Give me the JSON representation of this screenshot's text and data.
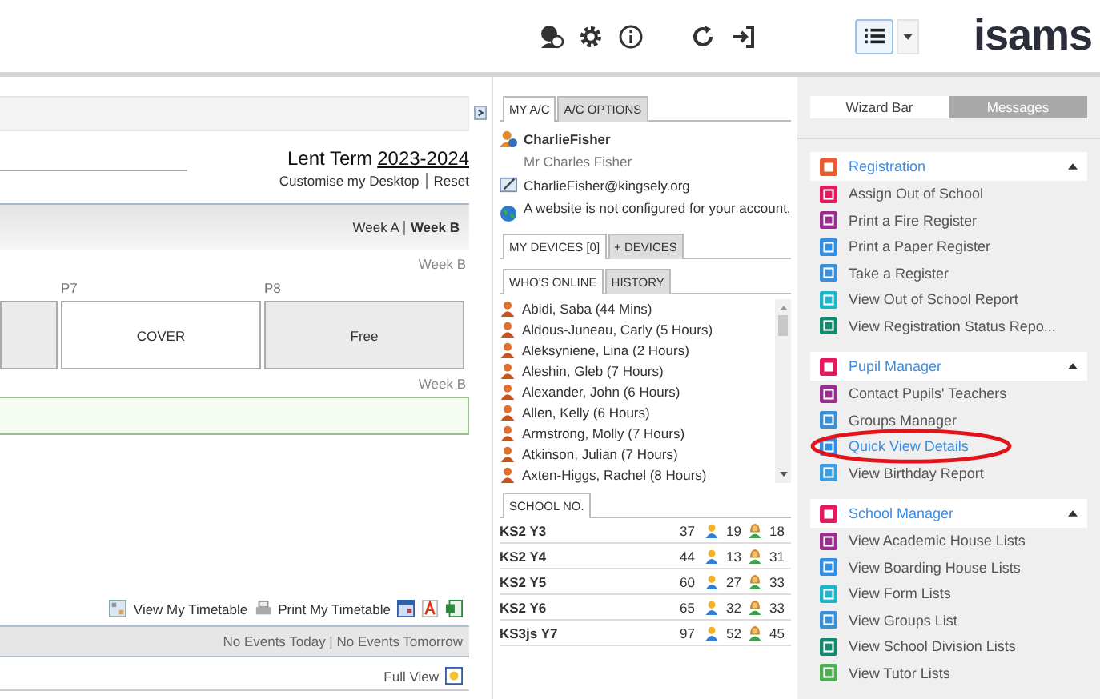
{
  "toolbar": {
    "logo": "isams"
  },
  "desktop": {
    "term": "Lent Term",
    "year": "2023-2024",
    "links": [
      "Customise my Desktop",
      "Reset"
    ],
    "weeks": [
      {
        "label": "Week A",
        "selected": false
      },
      {
        "label": "Week B",
        "selected": true
      }
    ],
    "week_label_top": "Week B",
    "periods": [
      {
        "label": "P7",
        "cell": "COVER",
        "kind": "cover"
      },
      {
        "label": "P8",
        "cell": "Free",
        "kind": "free"
      }
    ],
    "week_label_bottom": "Week B",
    "timetable_links": [
      "View My Timetable",
      "Print My Timetable"
    ],
    "events": "No Events Today | No Events Tomorrow",
    "full_view": "Full View"
  },
  "account": {
    "tabs": [
      {
        "label": "MY A/C",
        "selected": true
      },
      {
        "label": "A/C OPTIONS",
        "selected": false
      }
    ],
    "username": "CharlieFisher",
    "full_name": "Mr Charles Fisher",
    "email": "CharlieFisher@kingsely.org",
    "website": "A website is not configured for your account.",
    "device_tabs": [
      {
        "label": "MY DEVICES [0]",
        "selected": true
      },
      {
        "label": "+ DEVICES",
        "selected": false
      }
    ],
    "online_tabs": [
      {
        "label": "WHO'S ONLINE",
        "selected": true
      },
      {
        "label": "HISTORY",
        "selected": false
      }
    ],
    "online": [
      "Abidi, Saba (44 Mins)",
      "Aldous-Juneau, Carly (5 Hours)",
      "Aleksyniene, Lina (2 Hours)",
      "Aleshin, Gleb (7 Hours)",
      "Alexander, John (6 Hours)",
      "Allen, Kelly (6 Hours)",
      "Armstrong, Molly (7 Hours)",
      "Atkinson, Julian (7 Hours)",
      "Axten-Higgs, Rachel (8 Hours)"
    ],
    "school_tab": "SCHOOL NO.",
    "school_rows": [
      {
        "name": "KS2 Y3",
        "total": "37",
        "boys": "19",
        "girls": "18"
      },
      {
        "name": "KS2 Y4",
        "total": "44",
        "boys": "13",
        "girls": "31"
      },
      {
        "name": "KS2 Y5",
        "total": "60",
        "boys": "27",
        "girls": "33"
      },
      {
        "name": "KS2 Y6",
        "total": "65",
        "boys": "32",
        "girls": "33"
      },
      {
        "name": "KS3js Y7",
        "total": "97",
        "boys": "52",
        "girls": "45"
      }
    ]
  },
  "wizard": {
    "tabs": [
      {
        "label": "Wizard Bar",
        "selected": true
      },
      {
        "label": "Messages",
        "selected": false
      }
    ],
    "sections": [
      {
        "title": "Registration",
        "color": "#ee5a2f",
        "expanded": true,
        "items": [
          {
            "label": "Assign Out of School",
            "color": "#e8185e",
            "selected": false
          },
          {
            "label": "Print a Fire Register",
            "color": "#9b2d91",
            "selected": false
          },
          {
            "label": "Print a Paper Register",
            "color": "#2d8fe8",
            "selected": false
          },
          {
            "label": "Take a Register",
            "color": "#3a8fd6",
            "selected": false
          },
          {
            "label": "View Out of School Report",
            "color": "#1cb5c9",
            "selected": false
          },
          {
            "label": "View Registration Status Repo...",
            "color": "#128a6e",
            "selected": false
          }
        ]
      },
      {
        "title": "Pupil Manager",
        "color": "#e8185e",
        "expanded": true,
        "items": [
          {
            "label": "Contact Pupils' Teachers",
            "color": "#9b2d91",
            "selected": false
          },
          {
            "label": "Groups Manager",
            "color": "#3a8fd6",
            "selected": false
          },
          {
            "label": "Quick View Details",
            "color": "#2d8fe8",
            "selected": true
          },
          {
            "label": "View Birthday Report",
            "color": "#3a9ee0",
            "selected": false
          }
        ]
      },
      {
        "title": "School Manager",
        "color": "#e8185e",
        "expanded": true,
        "items": [
          {
            "label": "View Academic House Lists",
            "color": "#9b2d91",
            "selected": false
          },
          {
            "label": "View Boarding House Lists",
            "color": "#2d8fe8",
            "selected": false
          },
          {
            "label": "View Form Lists",
            "color": "#1cb5c9",
            "selected": false
          },
          {
            "label": "View Groups List",
            "color": "#3a8fd6",
            "selected": false
          },
          {
            "label": "View School Division Lists",
            "color": "#128a6e",
            "selected": false
          },
          {
            "label": "View Tutor Lists",
            "color": "#4caf50",
            "selected": false
          }
        ]
      }
    ]
  }
}
